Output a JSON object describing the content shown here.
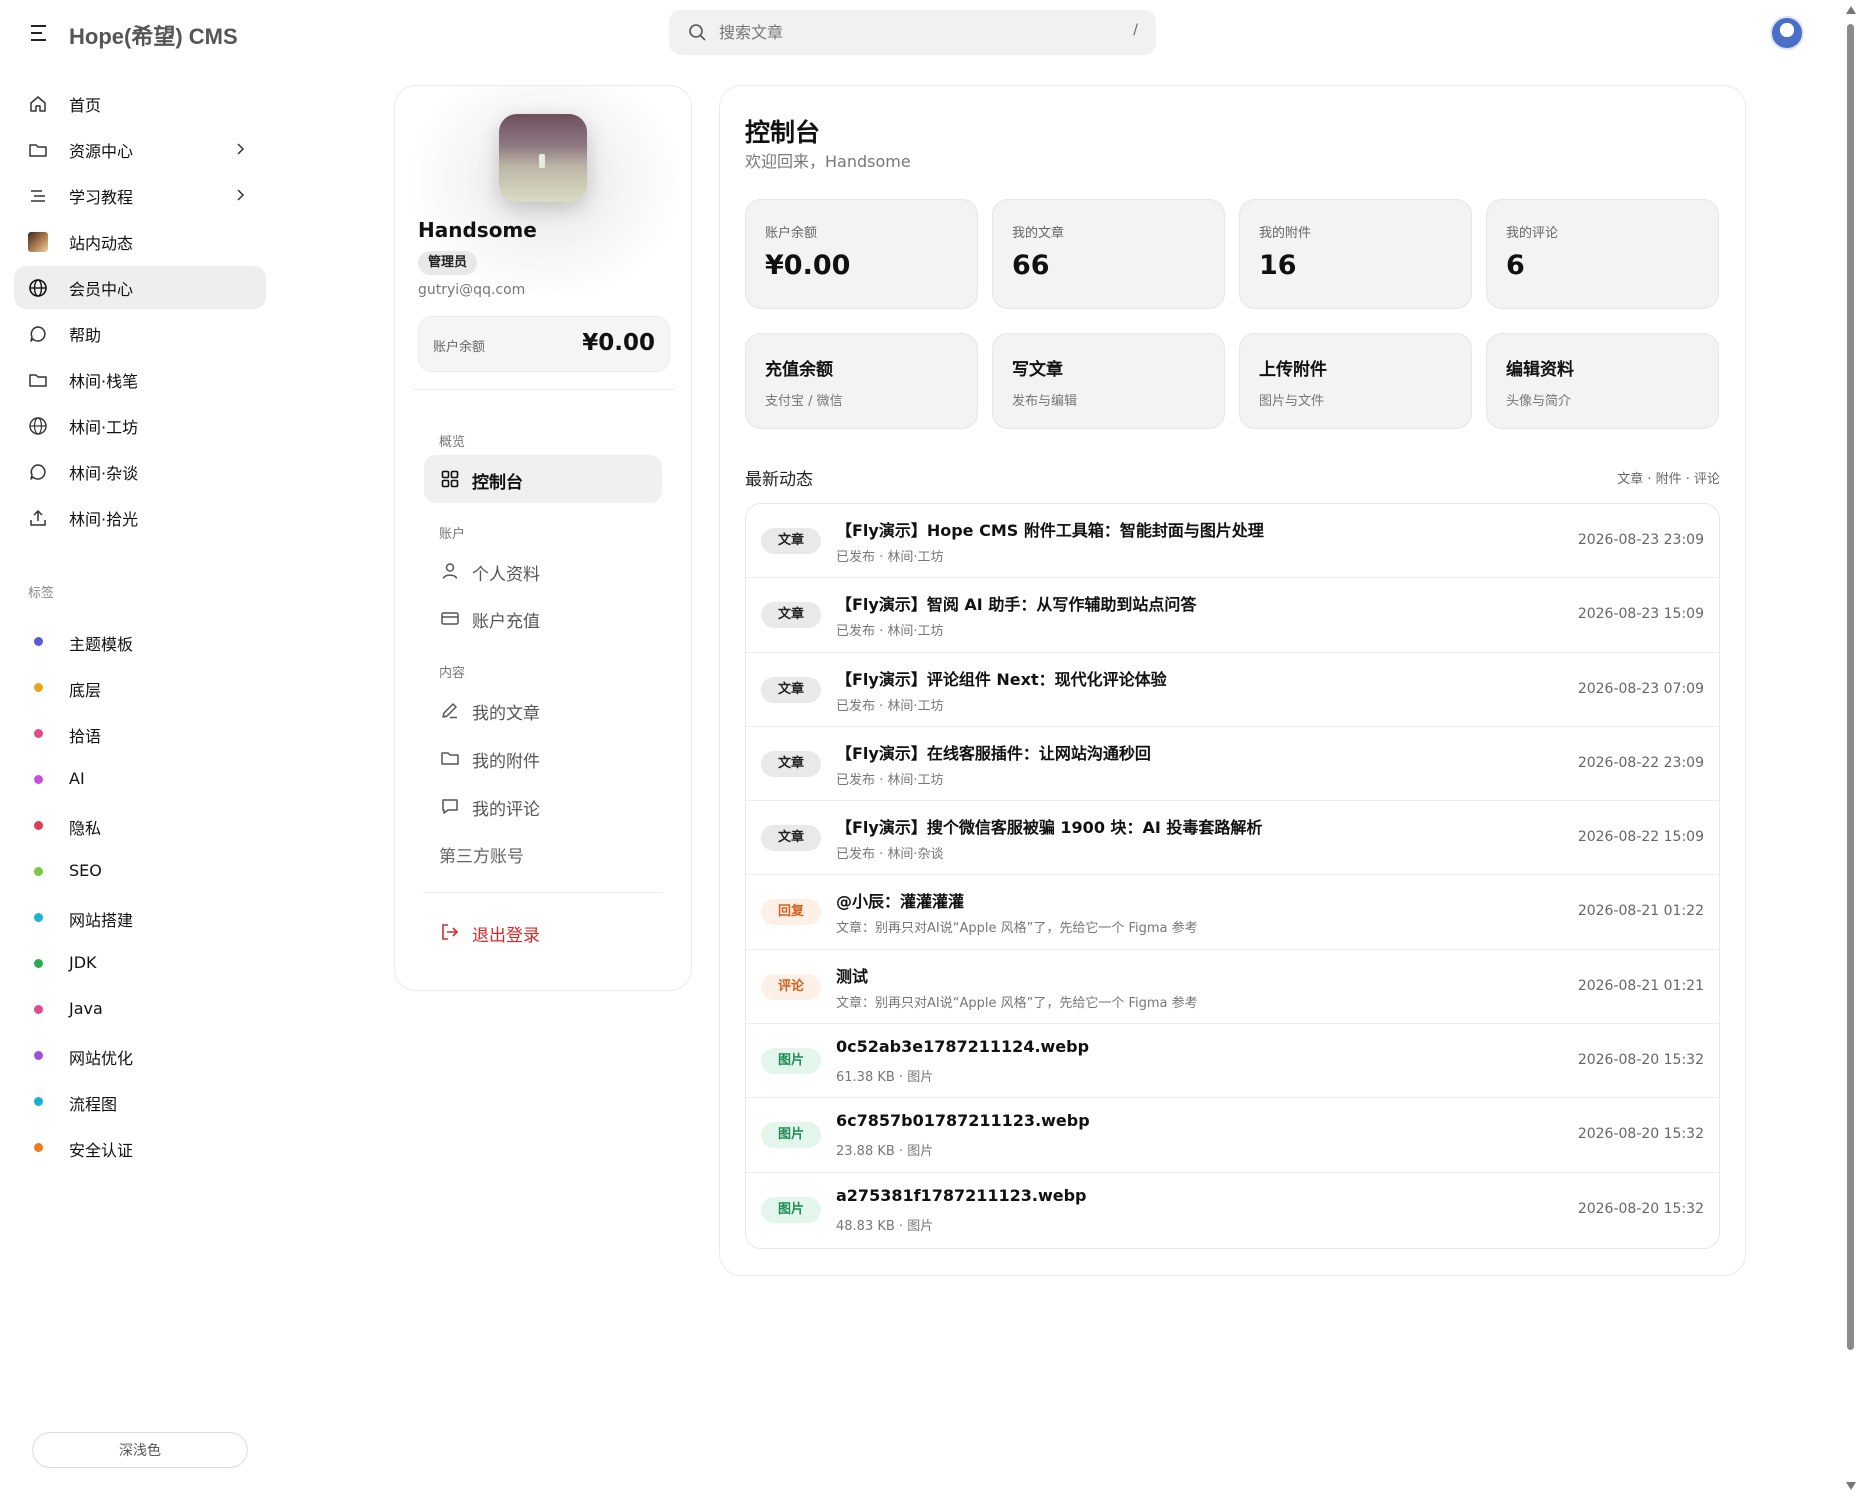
{
  "header": {
    "brand": "Hope(希望) CMS",
    "search_placeholder": "搜索文章",
    "search_shortcut": "/"
  },
  "sidebar": {
    "items": [
      {
        "label": "首页",
        "icon": "home-icon"
      },
      {
        "label": "资源中心",
        "icon": "folder-icon",
        "expandable": true
      },
      {
        "label": "学习教程",
        "icon": "list-icon",
        "expandable": true
      },
      {
        "label": "站内动态",
        "icon": "thumbnail-icon"
      },
      {
        "label": "会员中心",
        "icon": "globe-icon",
        "active": true
      },
      {
        "label": "帮助",
        "icon": "chat-icon"
      },
      {
        "label": "林间·栈笔",
        "icon": "folder-icon"
      },
      {
        "label": "林间·工坊",
        "icon": "globe-icon"
      },
      {
        "label": "林间·杂谈",
        "icon": "chat-icon"
      },
      {
        "label": "林间·拾光",
        "icon": "upload-icon"
      }
    ],
    "tags_title": "标签",
    "tags": [
      {
        "label": "主题模板",
        "color": "#5b5bd6"
      },
      {
        "label": "底层",
        "color": "#e8a51a"
      },
      {
        "label": "拾语",
        "color": "#e44a86"
      },
      {
        "label": "AI",
        "color": "#c94ee0"
      },
      {
        "label": "隐私",
        "color": "#e03a55"
      },
      {
        "label": "SEO",
        "color": "#7ac943"
      },
      {
        "label": "网站搭建",
        "color": "#19b6c9"
      },
      {
        "label": "JDK",
        "color": "#2cae4e"
      },
      {
        "label": "Java",
        "color": "#e04a8c"
      },
      {
        "label": "网站优化",
        "color": "#a04ee0"
      },
      {
        "label": "流程图",
        "color": "#19b0d6"
      },
      {
        "label": "安全认证",
        "color": "#f07a1e"
      }
    ],
    "theme_toggle": "深浅色"
  },
  "profile": {
    "name": "Handsome",
    "role": "管理员",
    "email": "gutryi@qq.com",
    "balance_label": "账户余额",
    "balance_value": "¥0.00",
    "sections": {
      "overview": "概览",
      "account": "账户",
      "content": "内容"
    },
    "menu": {
      "dashboard": "控制台",
      "profile": "个人资料",
      "recharge": "账户充值",
      "articles": "我的文章",
      "attachments": "我的附件",
      "comments": "我的评论",
      "third_party": "第三方账号",
      "logout": "退出登录"
    }
  },
  "main": {
    "title": "控制台",
    "subtitle": "欢迎回来，Handsome",
    "stats": [
      {
        "label": "账户余额",
        "value": "¥0.00"
      },
      {
        "label": "我的文章",
        "value": "66"
      },
      {
        "label": "我的附件",
        "value": "16"
      },
      {
        "label": "我的评论",
        "value": "6"
      }
    ],
    "actions": [
      {
        "label": "充值余额",
        "sub": "支付宝 / 微信"
      },
      {
        "label": "写文章",
        "sub": "发布与编辑"
      },
      {
        "label": "上传附件",
        "sub": "图片与文件"
      },
      {
        "label": "编辑资料",
        "sub": "头像与简介"
      }
    ],
    "activity_title": "最新动态",
    "activity_filter": "文章 · 附件 · 评论",
    "activities": [
      {
        "badge": "文章",
        "type": "article",
        "title": "【Fly演示】Hope CMS 附件工具箱：智能封面与图片处理",
        "meta": "已发布 · 林间·工坊",
        "date": "2026-08-23 23:09"
      },
      {
        "badge": "文章",
        "type": "article",
        "title": "【Fly演示】智阅 AI 助手：从写作辅助到站点问答",
        "meta": "已发布 · 林间·工坊",
        "date": "2026-08-23 15:09"
      },
      {
        "badge": "文章",
        "type": "article",
        "title": "【Fly演示】评论组件 Next：现代化评论体验",
        "meta": "已发布 · 林间·工坊",
        "date": "2026-08-23 07:09"
      },
      {
        "badge": "文章",
        "type": "article",
        "title": "【Fly演示】在线客服插件：让网站沟通秒回",
        "meta": "已发布 · 林间·工坊",
        "date": "2026-08-22 23:09"
      },
      {
        "badge": "文章",
        "type": "article",
        "title": "【Fly演示】搜个微信客服被骗 1900 块：AI 投毒套路解析",
        "meta": "已发布 · 林间·杂谈",
        "date": "2026-08-22 15:09"
      },
      {
        "badge": "回复",
        "type": "reply",
        "title": "@小辰：灌灌灌灌",
        "meta": "文章：别再只对AI说“Apple 风格”了，先给它一个 Figma 参考",
        "date": "2026-08-21 01:22"
      },
      {
        "badge": "评论",
        "type": "comment",
        "title": "测试",
        "meta": "文章：别再只对AI说“Apple 风格”了，先给它一个 Figma 参考",
        "date": "2026-08-21 01:21"
      },
      {
        "badge": "图片",
        "type": "image",
        "title": "0c52ab3e1787211124.webp",
        "meta": "61.38 KB · 图片",
        "date": "2026-08-20 15:32"
      },
      {
        "badge": "图片",
        "type": "image",
        "title": "6c7857b01787211123.webp",
        "meta": "23.88 KB · 图片",
        "date": "2026-08-20 15:32"
      },
      {
        "badge": "图片",
        "type": "image",
        "title": "a275381f1787211123.webp",
        "meta": "48.83 KB · 图片",
        "date": "2026-08-20 15:32"
      }
    ]
  }
}
